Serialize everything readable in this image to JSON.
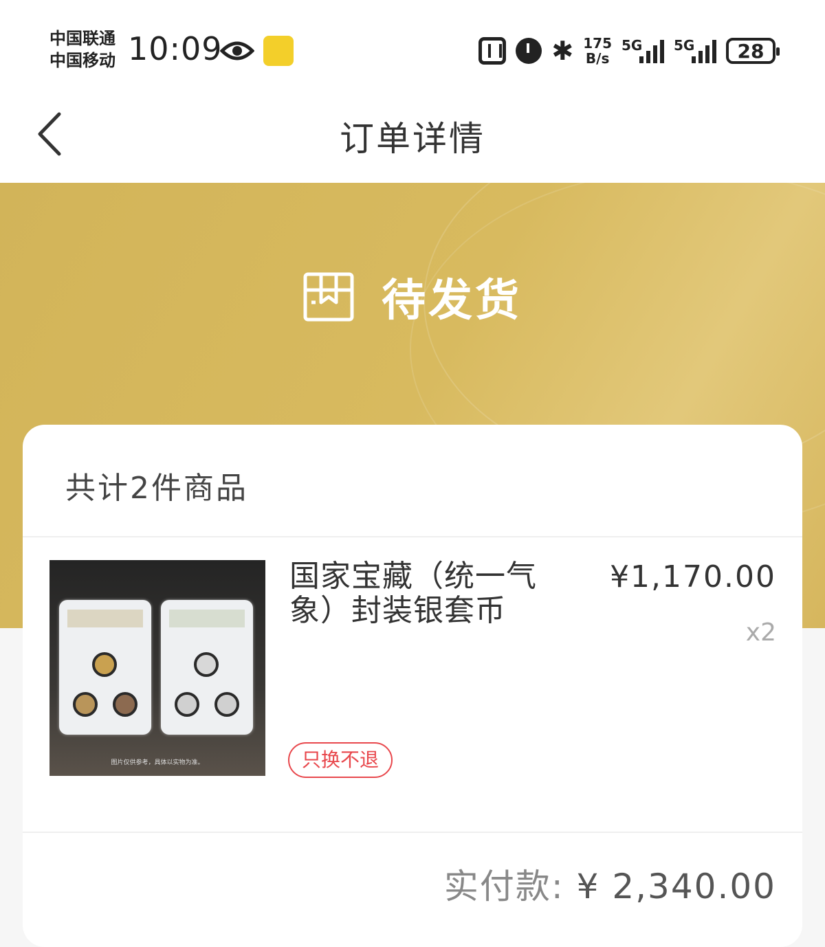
{
  "status_bar": {
    "carrier_1": "中国联通",
    "carrier_2": "中国移动",
    "time": "10:09",
    "net_speed_value": "175",
    "net_speed_unit": "B/s",
    "signal_1_label": "5G",
    "signal_2_label": "5G",
    "battery": "28"
  },
  "header": {
    "title": "订单详情"
  },
  "banner": {
    "order_status": "待发货",
    "color": "#d6b75e"
  },
  "order": {
    "item_count_text": "共计2件商品",
    "product": {
      "name": "国家宝藏（统一气象）封装银套币",
      "price": "¥1,170.00",
      "quantity": "x2",
      "policy_tag": "只换不退",
      "image_caption": "图片仅供参考，具体以实物为准。"
    },
    "paid_label": "实付款:",
    "paid_amount": "¥ 2,340.00"
  },
  "colors": {
    "accent_gold": "#d6b75e",
    "tag_red": "#e8474c"
  }
}
